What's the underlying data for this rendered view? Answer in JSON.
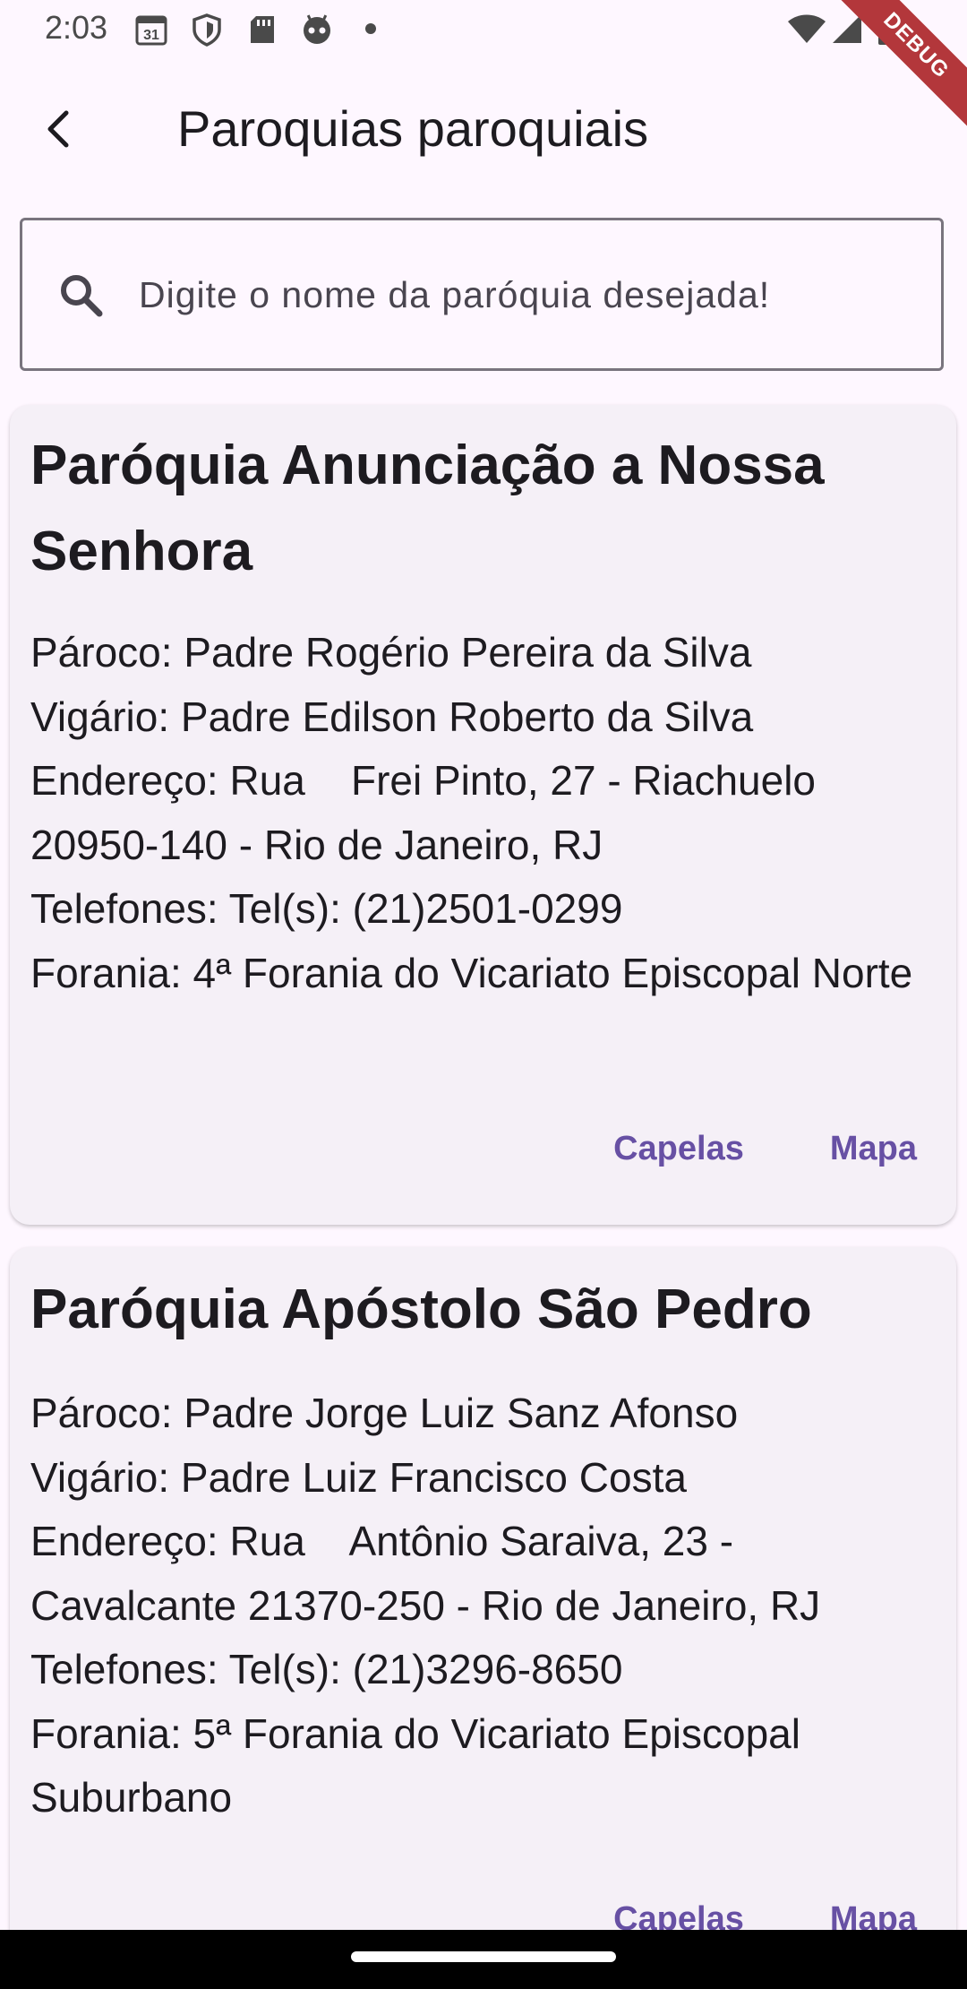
{
  "status_bar": {
    "time": "2:03",
    "calendar_day": "31",
    "debug_label": "DEBUG"
  },
  "app_bar": {
    "title": "Paroquias paroquiais"
  },
  "search": {
    "placeholder": "Digite o nome da paróquia desejada!"
  },
  "parishes": [
    {
      "name": "Paróquia Anunciação a Nossa Senhora",
      "paroco": "Pároco: Padre Rogério Pereira da Silva",
      "vigario": "Vigário: Padre Edilson Roberto da Silva",
      "endereco": "Endereço: Rua    Frei Pinto, 27 - Riachuelo 20950-140 - Rio de Janeiro, RJ",
      "telefones": "Telefones: Tel(s): (21)2501-0299",
      "forania": "Forania: 4ª Forania do Vicariato Episcopal Norte",
      "capelas_label": "Capelas",
      "mapa_label": "Mapa"
    },
    {
      "name": "Paróquia Apóstolo São Pedro",
      "paroco": "Pároco: Padre Jorge Luiz Sanz Afonso",
      "vigario": "Vigário: Padre Luiz Francisco Costa",
      "endereco": "Endereço: Rua    Antônio Saraiva, 23 - Cavalcante 21370-250 - Rio de Janeiro, RJ",
      "telefones": "Telefones: Tel(s): (21)3296-8650",
      "forania": "Forania: 5ª Forania do Vicariato Episcopal Suburbano",
      "capelas_label": "Capelas",
      "mapa_label": "Mapa"
    }
  ],
  "colors": {
    "background": "#fef7ff",
    "card": "#f5f0f7",
    "accent": "#6750a4",
    "debug_banner": "#b3373b"
  }
}
